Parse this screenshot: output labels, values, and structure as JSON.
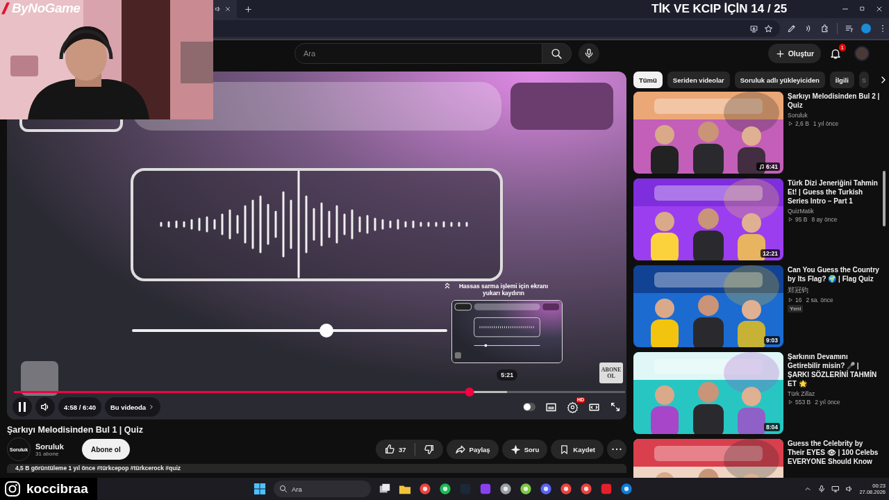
{
  "overlay": {
    "streamer_logo": "ByNoGame",
    "counter": "TİK VE KCIP İÇİN 14 / 25",
    "instagram": "koccibraa"
  },
  "masthead": {
    "search": {
      "placeholder": "Ara"
    },
    "create_button": "Oluştur",
    "notifications": "1"
  },
  "player": {
    "autoplay": false,
    "level": 0.745,
    "time": "4:58 / 6:40",
    "chapter": "Bu videoda",
    "seek_hint": "Hassas sarma işlemi için ekranı yukarı kaydırın",
    "hover": {
      "time": "5:21",
      "level": 0.807
    },
    "watermark": "ABONE OL",
    "settings_badge": "HD"
  },
  "video": {
    "title": "Şarkıyı Melodisinden Bul 1 | Quiz",
    "channel": "Soruluk",
    "channel_avatar": "Soruluk",
    "subscribers": "31 abone",
    "subscribe_button": "Abone ol",
    "likes": "37",
    "actions": [
      "Paylaş",
      "Soru",
      "Kaydet"
    ],
    "description": "4,5 B görüntüleme  1 yıl önce  #türkcepop #türkcerock #quiz"
  },
  "chips": [
    {
      "label": "Tümü",
      "selected": true
    },
    {
      "label": "Seriden videolar",
      "selected": false
    },
    {
      "label": "Soruluk adlı yükleyiciden",
      "selected": false
    },
    {
      "label": "İlgili",
      "selected": false
    },
    {
      "label": "S",
      "selected": false
    }
  ],
  "recommendations": [
    {
      "title": "Şarkıyı Melodisinden Bul 2  |  Quiz",
      "channel": "Soruluk",
      "views": "2,6 B",
      "age": "1 yıl önce",
      "duration": "6:41",
      "music": true
    },
    {
      "title": "Türk Dizi Jeneriğini Tahmin Et! | Guess the Turkish Series Intro – Part 1",
      "channel": "QuizMatik",
      "views": "95 B",
      "age": "8 ay önce",
      "duration": "12:21",
      "music": false
    },
    {
      "title": "Can You Guess the Country by Its Flag? 🌍 | Flag Quiz",
      "channel": "郑冠钧",
      "views": "16",
      "age": "2 sa. önce",
      "duration": "9:03",
      "badge": "Yeni",
      "music": false
    },
    {
      "title": "Şarkının Devamını Getirebilir misin? 🎤 | ŞARKI SÖZLERİNİ TAHMİN ET 🌟",
      "channel": "Türk Zillaz",
      "views": "553 B",
      "age": "2 yıl önce",
      "duration": "8:04",
      "music": false
    },
    {
      "title": "Guess the Celebrity by Their EYES 👁 | 100 Celebs EVERYONE Should Know",
      "music": false
    }
  ],
  "taskbar": {
    "search": "Ara",
    "time": "00:23",
    "date": "27.08.2026"
  }
}
